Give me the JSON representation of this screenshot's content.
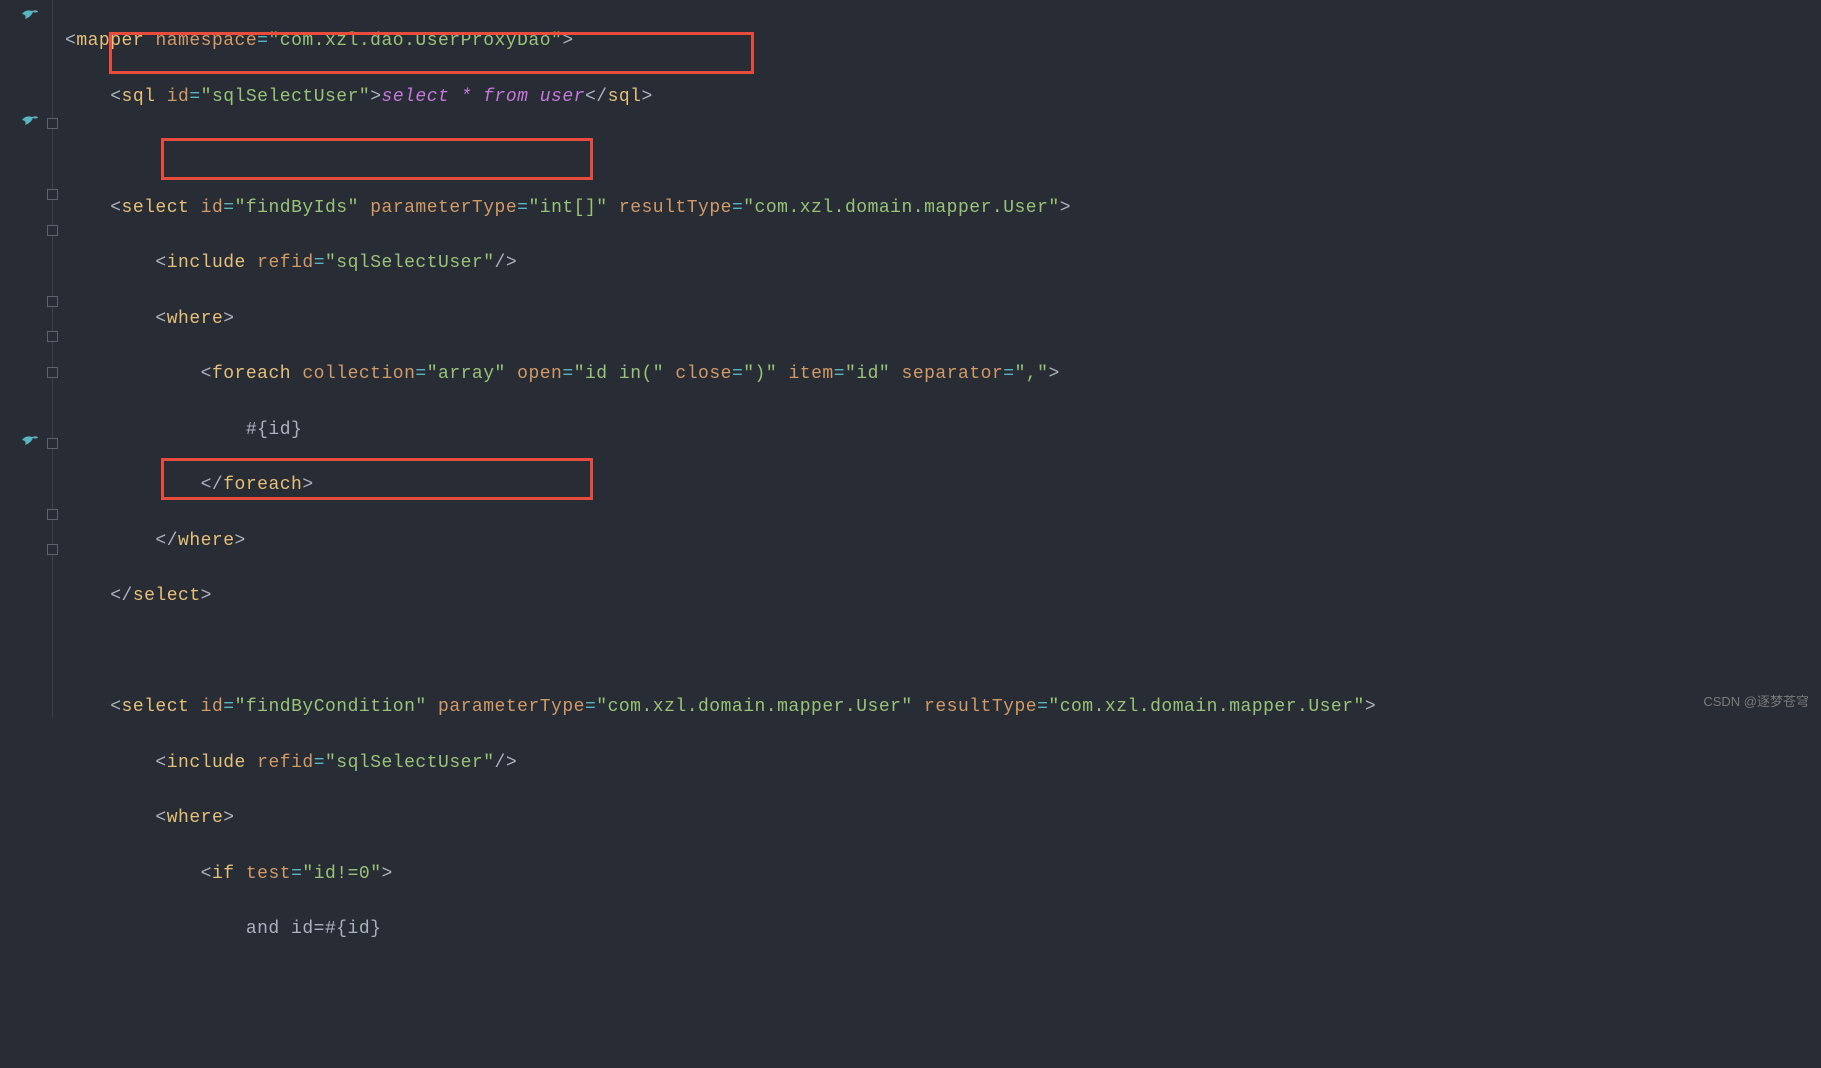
{
  "lines": {
    "l1_mapper_open": "mapper",
    "l1_ns_attr": "namespace",
    "l1_ns_val": "\"com.xzl.dao.UserProxyDao\"",
    "l2_sql": "sql",
    "l2_id_attr": "id",
    "l2_id_val": "\"sqlSelectUser\"",
    "l2_kw_select": "select",
    "l2_star": " * ",
    "l2_kw_from": "from",
    "l2_kw_user": " user",
    "l4_select": "select",
    "l4_id_attr": "id",
    "l4_id_val": "\"findByIds\"",
    "l4_pt_attr": "parameterType",
    "l4_pt_val": "\"int[]\"",
    "l4_rt_attr": "resultType",
    "l4_rt_val": "\"com.xzl.domain.mapper.User\"",
    "l5_include": "include",
    "l5_refid_attr": "refid",
    "l5_refid_val": "\"sqlSelectUser\"",
    "l6_where": "where",
    "l7_foreach": "foreach",
    "l7_coll_attr": "collection",
    "l7_coll_val": "\"array\"",
    "l7_open_attr": "open",
    "l7_open_val": "\"id in(\"",
    "l7_close_attr": "close",
    "l7_close_val": "\")\"",
    "l7_item_attr": "item",
    "l7_item_val": "\"id\"",
    "l7_sep_attr": "separator",
    "l7_sep_val": "\",\"",
    "l8_txt": "#{id}",
    "l9_foreach_c": "foreach",
    "l10_where_c": "where",
    "l11_select_c": "select",
    "l13_select": "select",
    "l13_id_attr": "id",
    "l13_id_val": "\"findByCondition\"",
    "l13_pt_attr": "parameterType",
    "l13_pt_val": "\"com.xzl.domain.mapper.User\"",
    "l13_rt_attr": "resultType",
    "l13_rt_val": "\"com.xzl.domain.mapper.User\"",
    "l14_include": "include",
    "l14_refid_attr": "refid",
    "l14_refid_val": "\"sqlSelectUser\"",
    "l15_where": "where",
    "l16_if": "if",
    "l16_test_attr": "test",
    "l16_test_val": "\"id!=0\"",
    "l17_txt": "and id=#{id}"
  },
  "watermark": "CSDN @逐梦苍穹"
}
